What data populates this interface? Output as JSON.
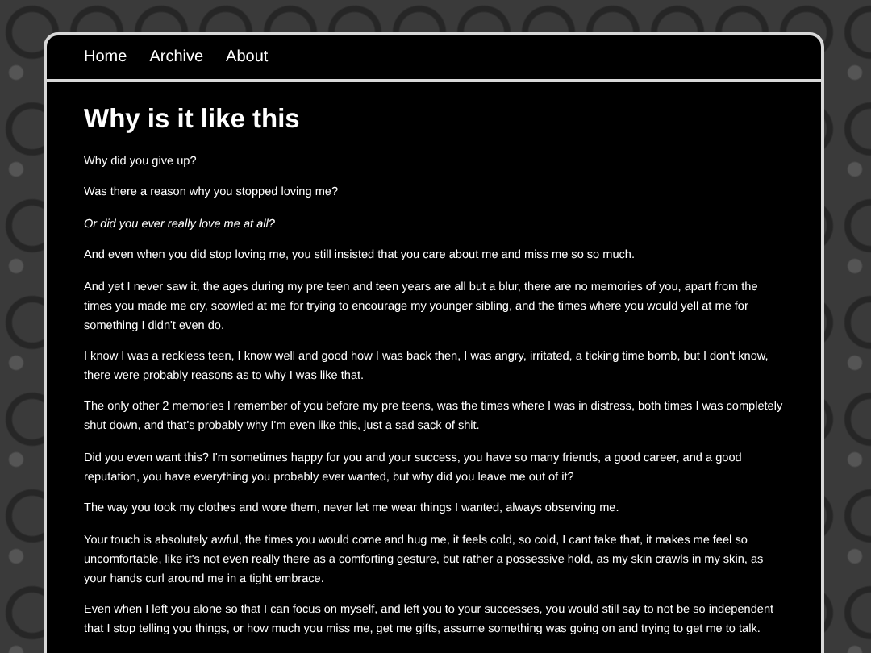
{
  "nav": [
    "Home",
    "Archive",
    "About"
  ],
  "post": {
    "title": "Why is it like this",
    "paragraphs": [
      {
        "text": "Why did you give up?",
        "italic": false
      },
      {
        "text": "Was there a reason why you stopped loving me?",
        "italic": false
      },
      {
        "text": "Or did you ever really love me at all?",
        "italic": true
      },
      {
        "text": "And even when you did stop loving me, you still insisted that you care about me and miss me so so much.",
        "italic": false
      },
      {
        "text": "And yet I never saw it, the ages during my pre teen and teen years are all but a blur, there are no memories of you, apart from the times you made me cry, scowled at me for trying to encourage my younger sibling, and the times where you would yell at me for something I didn't even do.",
        "italic": false
      },
      {
        "text": "I know I was a reckless teen, I know well and good how I was back then, I was angry, irritated, a ticking time bomb, but I don't know, there were probably reasons as to why I was like that.",
        "italic": false
      },
      {
        "text": "The only other 2 memories I remember of you before my pre teens, was the times where I was in distress, both times I was completely shut down, and that's probably why I'm even like this, just a sad sack of shit.",
        "italic": false
      },
      {
        "text": "Did you even want this? I'm sometimes happy for you and your success, you have so many friends, a good career, and a good reputation, you have everything you probably ever wanted, but why did you leave me out of it?",
        "italic": false
      },
      {
        "text": "The way you took my clothes and wore them, never let me wear things I wanted, always observing me.",
        "italic": false
      },
      {
        "text": "Your touch is absolutely awful, the times you would come and hug me, it feels cold, so cold, I cant take that, it makes me feel so uncomfortable, like it's not even really there as a comforting gesture, but rather a possessive hold, as my skin crawls in my skin, as your hands curl around me in a tight embrace.",
        "italic": false
      },
      {
        "text": "Even when I left you alone so that I can focus on myself, and left you to your successes, you would still say to not be so independent that I stop telling you things, or how much you miss me, get me gifts, assume something was going on and trying to get me to talk.",
        "italic": false
      }
    ]
  }
}
